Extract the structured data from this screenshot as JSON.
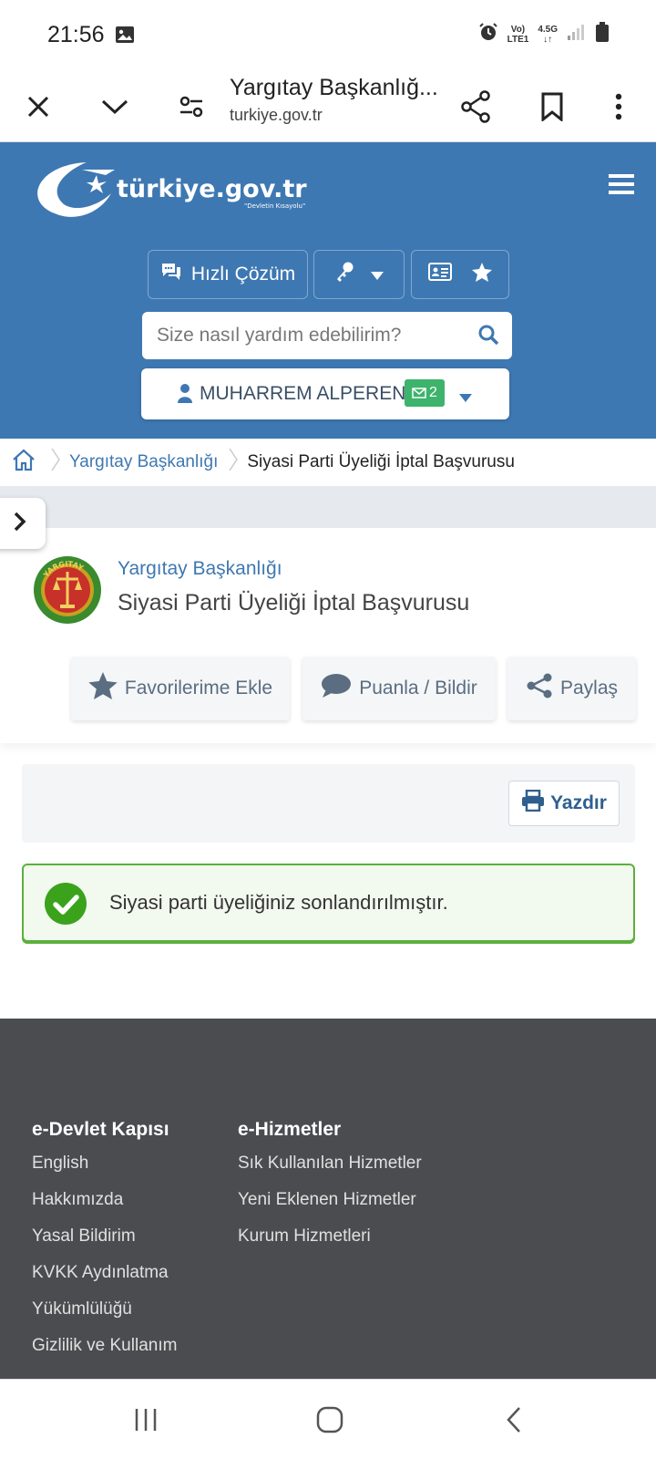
{
  "status_bar": {
    "time": "21:56",
    "network_top": "Vo)",
    "network_bottom": "LTE1",
    "network_type": "4.5G"
  },
  "browser": {
    "title": "Yargıtay Başkanlığ...",
    "url": "turkiye.gov.tr"
  },
  "header": {
    "logo_text": "türkiye.gov.tr",
    "logo_tagline": "\"Devletin Kısayolu\"",
    "quick_solution_label": "Hızlı Çözüm",
    "search_placeholder": "Size nasıl yardım edebilirim?",
    "user_name": "MUHARREM ALPEREN",
    "message_count": "2"
  },
  "breadcrumb": {
    "items": [
      "Yargıtay Başkanlığı",
      "Siyasi Parti Üyeliği İptal Başvurusu"
    ]
  },
  "service": {
    "institution": "Yargıtay Başkanlığı",
    "seal_text": "YARGITAY",
    "title": "Siyasi Parti Üyeliği İptal Başvurusu",
    "actions": {
      "favorite": "Favorilerime Ekle",
      "rate": "Puanla / Bildir",
      "share": "Paylaş"
    }
  },
  "print_label": "Yazdır",
  "alert": {
    "message": "Siyasi parti üyeliğiniz sonlandırılmıştır."
  },
  "footer": {
    "col1": {
      "title": "e-Devlet Kapısı",
      "links": [
        "English",
        "Hakkımızda",
        "Yasal Bildirim",
        "KVKK Aydınlatma",
        "Yükümlülüğü",
        "Gizlilik ve Kullanım"
      ]
    },
    "col2": {
      "title": "e-Hizmetler",
      "links": [
        "Sık Kullanılan Hizmetler",
        "Yeni Eklenen Hizmetler",
        "Kurum Hizmetleri"
      ]
    }
  },
  "colors": {
    "brand_blue": "#3e78b2",
    "success_green": "#3db36b",
    "footer_bg": "#4a4c4f"
  }
}
